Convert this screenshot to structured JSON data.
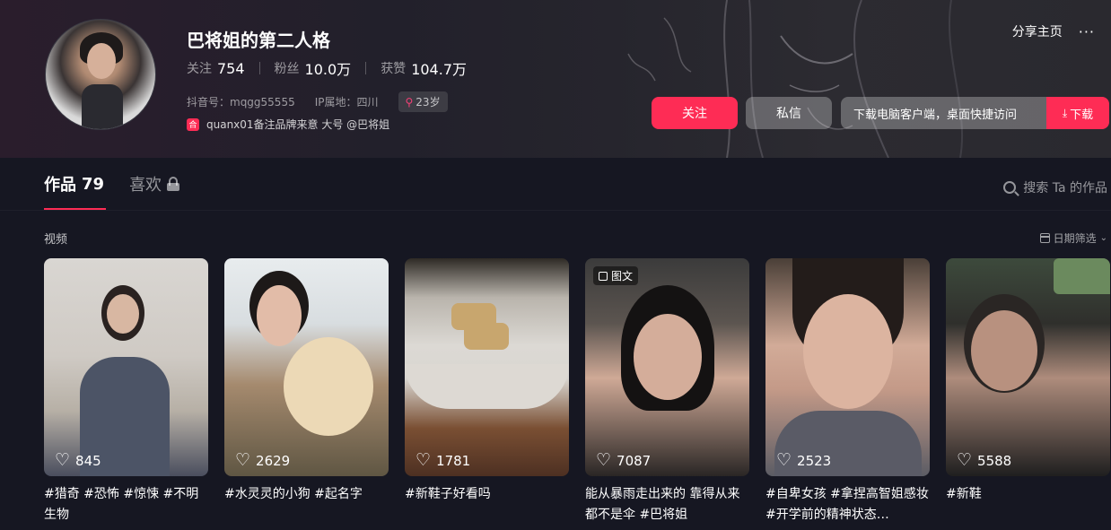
{
  "profile": {
    "name": "巴将姐的第二人格",
    "stats": [
      {
        "label": "关注",
        "value": "754"
      },
      {
        "label": "粉丝",
        "value": "10.0万"
      },
      {
        "label": "获赞",
        "value": "104.7万"
      }
    ],
    "douyin_id": "抖音号：mqgg55555",
    "ip_location": "IP属地：四川",
    "age": "23岁",
    "bio_tag": "合",
    "bio": "quanx01备注品牌来意 大号 @巴将姐"
  },
  "top_actions": {
    "share": "分享主页",
    "more": "···"
  },
  "actions": {
    "follow": "关注",
    "message": "私信",
    "download_tip": "下载电脑客户端，桌面快捷访问",
    "download": "下载"
  },
  "tabs": [
    {
      "label": "作品",
      "count": "79"
    },
    {
      "label": "喜欢",
      "count": ""
    }
  ],
  "search_works": "搜索 Ta 的作品",
  "section_label": "视频",
  "date_filter": "日期筛选",
  "videos": [
    {
      "likes": "845",
      "caption": "#猎奇 #恐怖 #惊悚 #不明生物",
      "badge": ""
    },
    {
      "likes": "2629",
      "caption": "#水灵灵的小狗 #起名字",
      "badge": ""
    },
    {
      "likes": "1781",
      "caption": "#新鞋子好看吗",
      "badge": ""
    },
    {
      "likes": "7087",
      "caption": "能从暴雨走出来的 靠得从来都不是伞 #巴将姐",
      "badge": "图文"
    },
    {
      "likes": "2523",
      "caption": "#自卑女孩 #拿捏高智姐感妆 #开学前的精神状态…",
      "badge": ""
    },
    {
      "likes": "5588",
      "caption": "#新鞋",
      "badge": ""
    }
  ],
  "colors": {
    "accent": "#fe2c55",
    "background": "#161722"
  }
}
